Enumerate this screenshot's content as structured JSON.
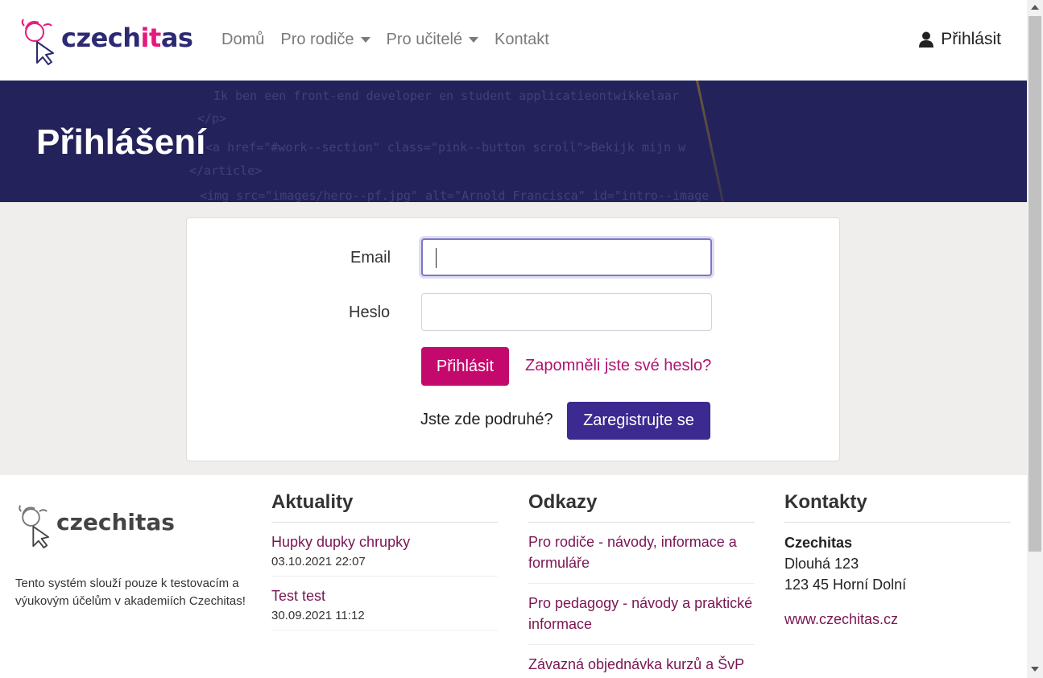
{
  "brand": {
    "logo_prefix": "czech",
    "logo_accent": "it",
    "logo_suffix": "as",
    "accent_color": "#e6197d",
    "primary_color": "#2d2a73"
  },
  "nav": {
    "items": [
      {
        "label": "Domů",
        "dropdown": false
      },
      {
        "label": "Pro rodiče",
        "dropdown": true
      },
      {
        "label": "Pro učitelé",
        "dropdown": true
      },
      {
        "label": "Kontakt",
        "dropdown": false
      }
    ],
    "login_label": "Přihlásit",
    "login_icon": "user-icon"
  },
  "hero": {
    "title": "Přihlášení",
    "code_lines": [
      "Ik ben een front-end developer en student applicatieontwikkelaar",
      "</p>",
      "<a href=\"#work--section\" class=\"pink--button scroll\">Bekijk mijn w",
      "</article>",
      "<img src=\"images/hero--pf.jpg\" alt=\"Arnold Francisca\" id=\"intro--image"
    ]
  },
  "login_form": {
    "email_label": "Email",
    "email_value": "",
    "password_label": "Heslo",
    "password_value": "",
    "submit_label": "Přihlásit",
    "forgot_label": "Zapomněli jste své heslo?",
    "second_visit_text": "Jste zde podruhé?",
    "register_label": "Zaregistrujte se",
    "submit_color": "#c4096d",
    "register_color": "#3c2a91"
  },
  "footer": {
    "logo_text": "czechitas",
    "description": "Tento systém slouží pouze k testovacím a výukovým účelům v akademiích Czechitas!",
    "news": {
      "heading": "Aktuality",
      "items": [
        {
          "title": "Hupky dupky chrupky",
          "date": "03.10.2021 22:07"
        },
        {
          "title": "Test test",
          "date": "30.09.2021 11:12"
        }
      ]
    },
    "links": {
      "heading": "Odkazy",
      "items": [
        "Pro rodiče - návody, informace a formuláře",
        "Pro pedagogy - návody a praktické informace",
        "Závazná objednávka kurzů a ŠvP"
      ]
    },
    "contacts": {
      "heading": "Kontakty",
      "name": "Czechitas",
      "street": "Dlouhá 123",
      "city": "123 45 Horní Dolní",
      "web": "www.czechitas.cz"
    }
  }
}
